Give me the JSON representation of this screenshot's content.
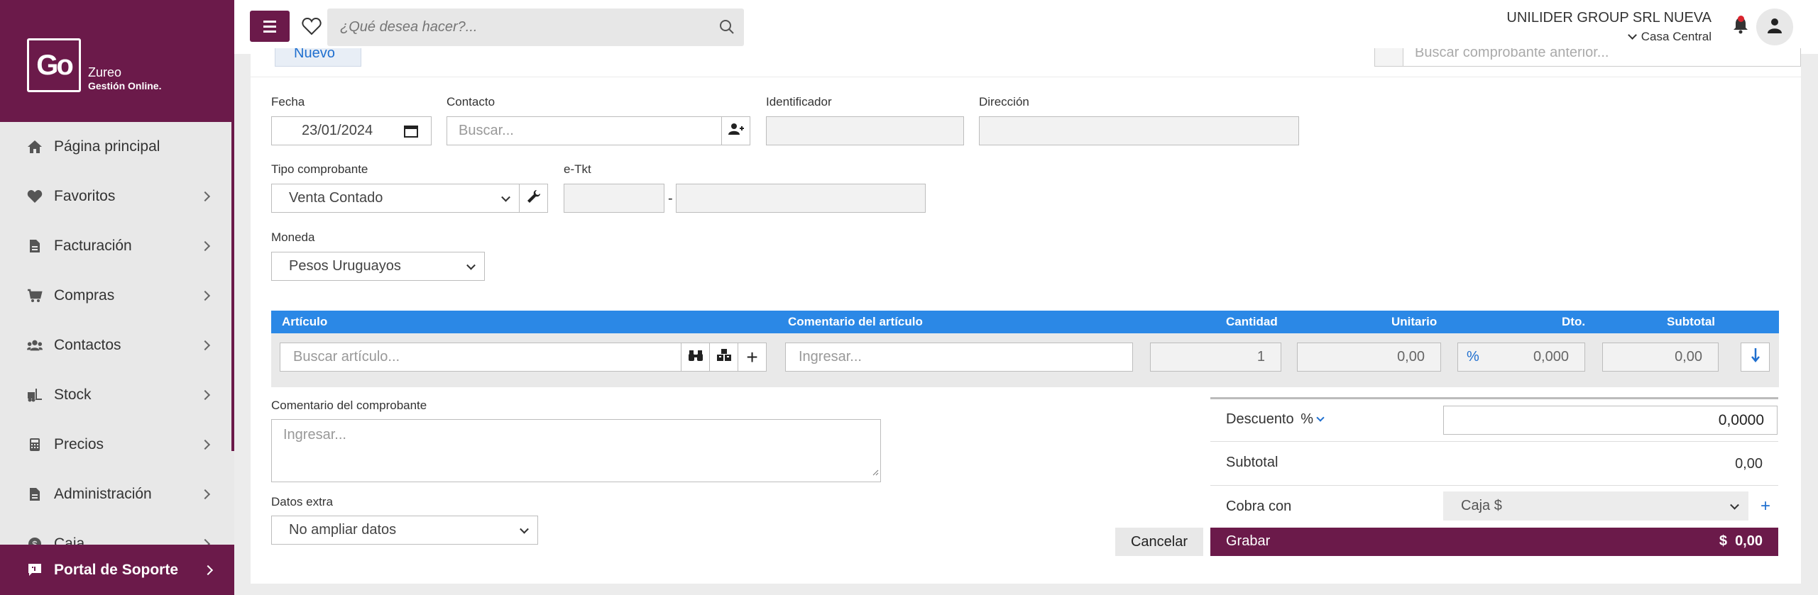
{
  "sidebar": {
    "logo_mark": "Go",
    "logo_line1": "Zureo",
    "logo_line2": "Gestión Online.",
    "items": [
      {
        "label": "Página principal",
        "icon": "home-icon"
      },
      {
        "label": "Favoritos",
        "icon": "heart-icon"
      },
      {
        "label": "Facturación",
        "icon": "document-icon"
      },
      {
        "label": "Compras",
        "icon": "cart-icon"
      },
      {
        "label": "Contactos",
        "icon": "users-icon"
      },
      {
        "label": "Stock",
        "icon": "forklift-icon"
      },
      {
        "label": "Precios",
        "icon": "calculator-icon"
      },
      {
        "label": "Administración",
        "icon": "document-icon"
      },
      {
        "label": "Caja",
        "icon": "coin-icon"
      }
    ],
    "support_label": "Portal de Soporte"
  },
  "topbar": {
    "search_placeholder": "¿Qué desea hacer?...",
    "company": "UNILIDER GROUP SRL NUEVA",
    "branch": "Casa Central"
  },
  "toolbar": {
    "new_label": "Nuevo",
    "prev_search_placeholder": "Buscar comprobante anterior..."
  },
  "form": {
    "fecha_label": "Fecha",
    "fecha_value": "23/01/2024",
    "contacto_label": "Contacto",
    "contacto_placeholder": "Buscar...",
    "identificador_label": "Identificador",
    "direccion_label": "Dirección",
    "tipo_label": "Tipo comprobante",
    "tipo_value": "Venta Contado",
    "etkt_label": "e-Tkt",
    "etkt_sep": "-",
    "moneda_label": "Moneda",
    "moneda_value": "Pesos Uruguayos"
  },
  "grid": {
    "columns": [
      "Artículo",
      "Comentario del artículo",
      "Cantidad",
      "Unitario",
      "Dto.",
      "Subtotal"
    ],
    "articulo_placeholder": "Buscar artículo...",
    "comentario_placeholder": "Ingresar...",
    "cantidad": "1",
    "unitario": "0,00",
    "dto_symbol": "%",
    "dto": "0,000",
    "subtotal": "0,00"
  },
  "comment": {
    "label": "Comentario del comprobante",
    "placeholder": "Ingresar..."
  },
  "extra": {
    "label": "Datos extra",
    "value": "No ampliar datos"
  },
  "totals": {
    "descuento_label": "Descuento",
    "descuento_symbol": "%",
    "descuento_value": "0,0000",
    "subtotal_label": "Subtotal",
    "subtotal_value": "0,00",
    "cobra_label": "Cobra con",
    "cobra_value": "Caja $",
    "cobra_add": "+"
  },
  "actions": {
    "cancel_label": "Cancelar",
    "save_label": "Grabar",
    "total_currency": "$",
    "total_value": "0,00"
  },
  "colors": {
    "brand": "#6b1a4a",
    "grid_header": "#2b88e6"
  }
}
